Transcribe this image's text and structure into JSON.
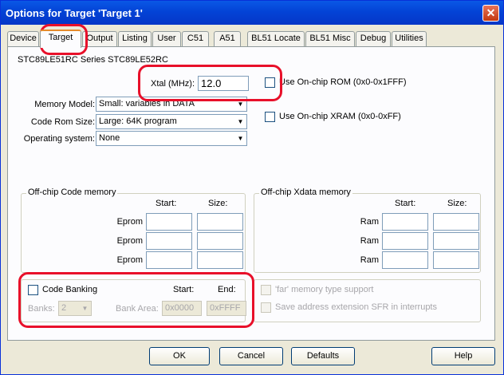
{
  "window": {
    "title": "Options for Target 'Target 1'",
    "close_icon": "close-icon"
  },
  "tabs": [
    "Device",
    "Target",
    "Output",
    "Listing",
    "User",
    "C51",
    "A51",
    "BL51 Locate",
    "BL51 Misc",
    "Debug",
    "Utilities"
  ],
  "active_tab": "Target",
  "device_label": "STC89LE51RC Series STC89LE52RC",
  "xtal": {
    "label": "Xtal (MHz):",
    "value": "12.0"
  },
  "memory_model": {
    "label": "Memory Model:",
    "value": "Small: variables in DATA"
  },
  "code_rom_size": {
    "label": "Code Rom Size:",
    "value": "Large: 64K program"
  },
  "operating_system": {
    "label": "Operating system:",
    "value": "None"
  },
  "use_onchip_rom": {
    "label": "Use On-chip ROM (0x0-0x1FFF)",
    "checked": false
  },
  "use_onchip_xram": {
    "label": "Use On-chip XRAM (0x0-0xFF)",
    "checked": false
  },
  "offchip_code": {
    "title": "Off-chip Code memory",
    "start_header": "Start:",
    "size_header": "Size:",
    "rows": [
      "Eprom",
      "Eprom",
      "Eprom"
    ]
  },
  "offchip_xdata": {
    "title": "Off-chip Xdata memory",
    "start_header": "Start:",
    "size_header": "Size:",
    "rows": [
      "Ram",
      "Ram",
      "Ram"
    ]
  },
  "code_banking": {
    "label": "Code Banking",
    "start_header": "Start:",
    "end_header": "End:",
    "banks_label": "Banks:",
    "banks_value": "2",
    "bank_area_label": "Bank Area:",
    "bank_area_start": "0x0000",
    "bank_area_end": "0xFFFF"
  },
  "far_memory_support": "'far' memory type support",
  "save_address_extension": "Save address extension SFR in interrupts",
  "buttons": {
    "ok": "OK",
    "cancel": "Cancel",
    "defaults": "Defaults",
    "help": "Help"
  },
  "colors": {
    "highlight": "#e8102a",
    "titlebar": "#0343d6"
  }
}
